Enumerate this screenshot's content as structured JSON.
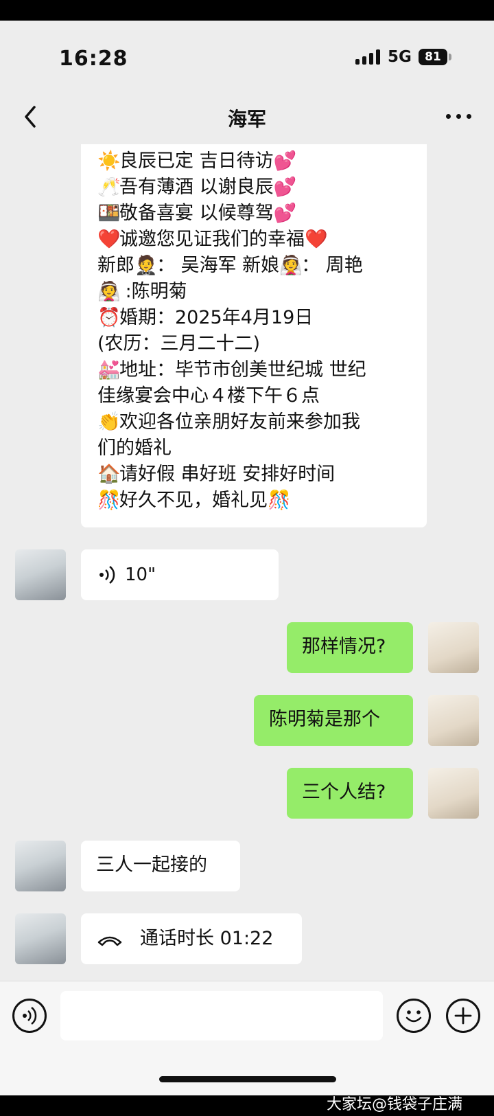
{
  "status_bar": {
    "time": "16:28",
    "network": "5G",
    "battery": "81"
  },
  "nav": {
    "title": "海军",
    "back_icon": "chevron-left-icon",
    "more_icon": "more-dots-icon"
  },
  "invitation": {
    "lines": [
      "良辰已定 吉日待访",
      "吾有薄酒 以谢良辰",
      "敬备喜宴 以候尊驾",
      "诚邀您见证我们的幸福",
      "新郎",
      "：  吴海军  新娘",
      "：  周艳",
      " :陈明菊",
      "婚期：2025年4月19日",
      "(农历：三月二十二)",
      "地址：毕节市创美世纪城  世纪",
      "佳缘宴会中心４楼下午６点",
      "欢迎各位亲朋好友前来参加我",
      "们的婚礼",
      "请好假 串好班 安排好时间",
      "好久不见，婚礼见"
    ],
    "emojis": {
      "sun": "☀️",
      "cheers": "🥂",
      "bento": "🍱",
      "hearts": "💕",
      "red_heart": "❤️",
      "groom": "🤵",
      "bride": "👰",
      "clock": "⏰",
      "wedding": "💒",
      "clap": "👏",
      "house": "🏠",
      "confetti": "🎊"
    }
  },
  "messages": {
    "voice_duration": "10\"",
    "out_1": "那样情况?",
    "out_2": "陈明菊是那个",
    "out_3": "三个人结?",
    "in_reply": "三人一起接的",
    "call_label": "通话时长 01:22"
  },
  "input_bar": {
    "voice_icon": "voice-toggle-icon",
    "emoji_icon": "emoji-icon",
    "plus_icon": "plus-icon"
  },
  "watermark": "大家坛@钱袋子庄满"
}
